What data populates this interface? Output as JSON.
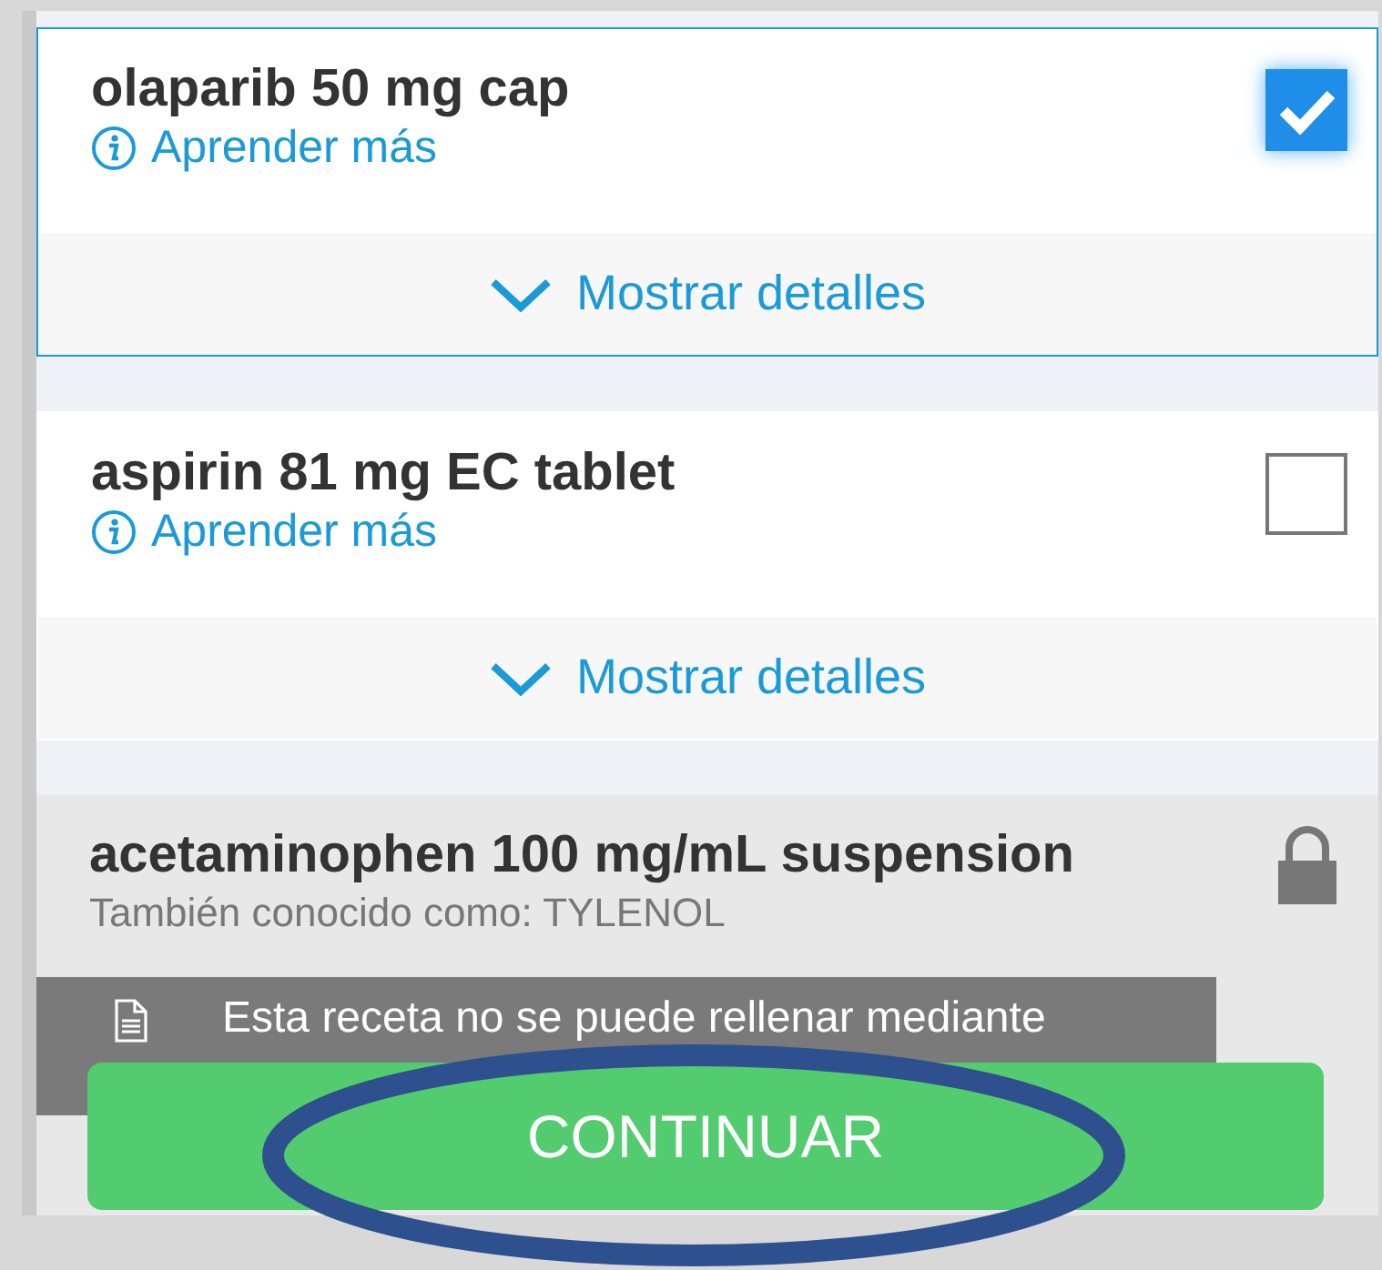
{
  "medications": [
    {
      "kind": "selectable",
      "name": "olaparib 50 mg cap",
      "link": "Aprender más",
      "details": "Mostrar detalles",
      "checked": true
    },
    {
      "kind": "selectable",
      "name": "aspirin 81 mg EC tablet",
      "link": "Aprender más",
      "details": "Mostrar detalles",
      "checked": false
    },
    {
      "kind": "locked",
      "name": "acetaminophen 100 mg/mL suspension",
      "aka": "También conocido como: TYLENOL",
      "notice": "Esta receta no se puede rellenar mediante"
    }
  ],
  "continue_button": "CONTINUAR"
}
